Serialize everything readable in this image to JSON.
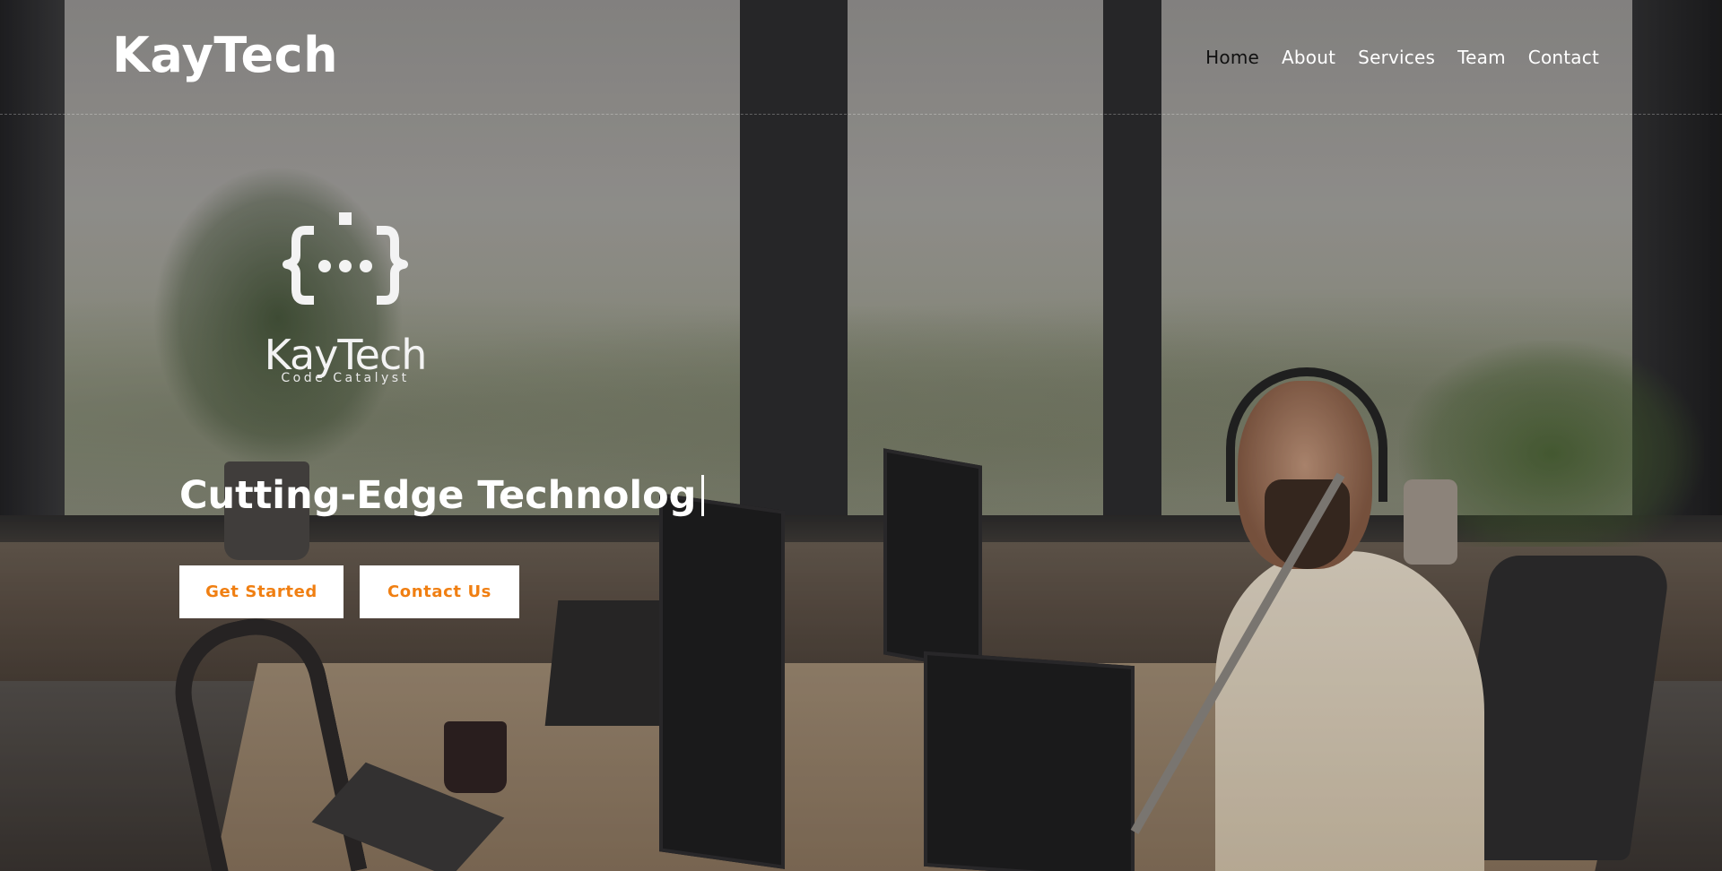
{
  "header": {
    "brand": "KayTech",
    "nav": [
      {
        "label": "Home",
        "active": true
      },
      {
        "label": "About",
        "active": false
      },
      {
        "label": "Services",
        "active": false
      },
      {
        "label": "Team",
        "active": false
      },
      {
        "label": "Contact",
        "active": false
      }
    ]
  },
  "hero": {
    "logo_icon": "braces-dots-icon",
    "logo_word": "KayTech",
    "logo_tagline": "Code Catalyst",
    "headline": "Cutting-Edge Technolog",
    "buttons": {
      "get_started": "Get Started",
      "contact_us": "Contact Us"
    }
  },
  "colors": {
    "accent": "#f07f12",
    "nav_active": "#111111",
    "text": "#ffffff"
  }
}
